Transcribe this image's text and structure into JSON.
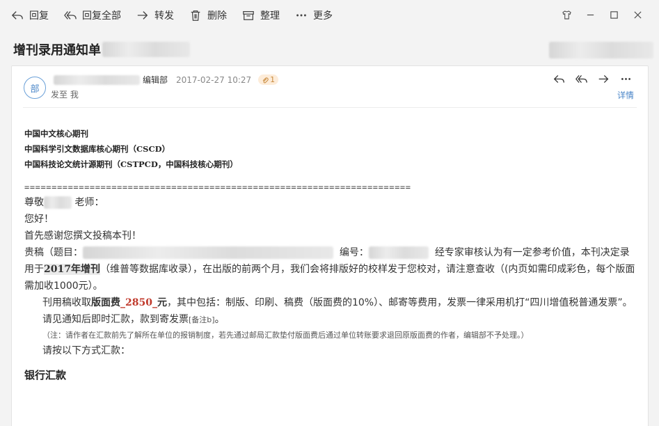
{
  "toolbar": {
    "items": [
      {
        "label": "回复",
        "icon": "reply-icon"
      },
      {
        "label": "回复全部",
        "icon": "reply-all-icon"
      },
      {
        "label": "转发",
        "icon": "forward-icon"
      },
      {
        "label": "删除",
        "icon": "delete-icon"
      },
      {
        "label": "整理",
        "icon": "archive-icon"
      },
      {
        "label": "更多",
        "icon": "more-icon"
      }
    ]
  },
  "subject": "增刊录用通知单",
  "message": {
    "avatar": "部",
    "sender_dept": "编辑部",
    "date": "2017-02-27 10:27",
    "attachments": "1",
    "to": "发至 我",
    "details": "详情"
  },
  "body": {
    "journal_lines": [
      "中国中文核心期刊",
      "中国科学引文数据库核心期刊（CSCD）",
      "中国科技论文统计源期刊（CSTPCD，中国科技核心期刊）"
    ],
    "separator": "=======================================================================",
    "greeting_pre": "尊敬",
    "greeting_post": "老师：",
    "hello": "您好！",
    "thanks": "首先感谢您撰文投稿本刊！",
    "para1_a": "贵稿（题目：",
    "para1_b": "编号：",
    "para1_c": "经专家审核认为有一定参考价值，本刊决定录用于",
    "para1_issue": "2017年增刊",
    "para1_d": "（维普等数据库收录），在出版的前两个月，我们会将排版好的校样发于您校对，请注意查收（(内页如需印成彩色，每个版面需加收1000元）。",
    "fee_a": "刊用稿收取",
    "fee_label": "版面费",
    "fee_amount": "_2850_",
    "fee_unit": "元",
    "fee_b": "，其中包括：制版、印刷、稿费（版面费的10%）、邮寄等费用，发票一律采用机打“四川增值税普通发票”。",
    "remit_a": "请见通知后即时汇款，款到寄发票",
    "remit_note": "[备注b]",
    "remit_end": "。",
    "note": "（注：请作者在汇款前先了解所在单位的报销制度，若先通过邮局汇款垫付版面费后通过单位转账要求退回原版面费的作者，编辑部不予处理。）",
    "method": "请按以下方式汇款：",
    "bank": "银行汇款"
  }
}
